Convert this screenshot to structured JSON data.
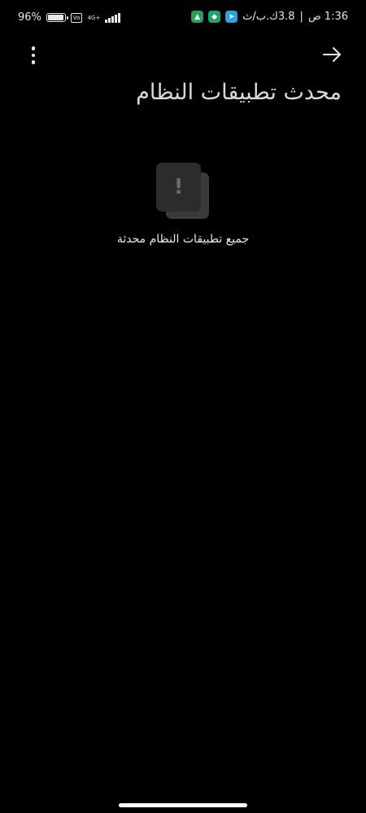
{
  "status_bar": {
    "battery_text": "96%",
    "battery_level": 0.96,
    "volte_label": "VoLTE",
    "network_label": "4G+",
    "time": "1:36 ص",
    "data_speed": "3.8ك.ب/ث",
    "separator": "|"
  },
  "toolbar": {
    "menu_icon": "more-vert-icon",
    "back_icon": "arrow-right-icon"
  },
  "header": {
    "title": "محدث تطبيقات النظام"
  },
  "empty_state": {
    "icon_symbol": "!",
    "message": "جميع تطبيقات النظام محدثة"
  },
  "colors": {
    "background": "#000000",
    "title_text": "#d8d8d8",
    "icon_card": "#2c2c2c"
  }
}
